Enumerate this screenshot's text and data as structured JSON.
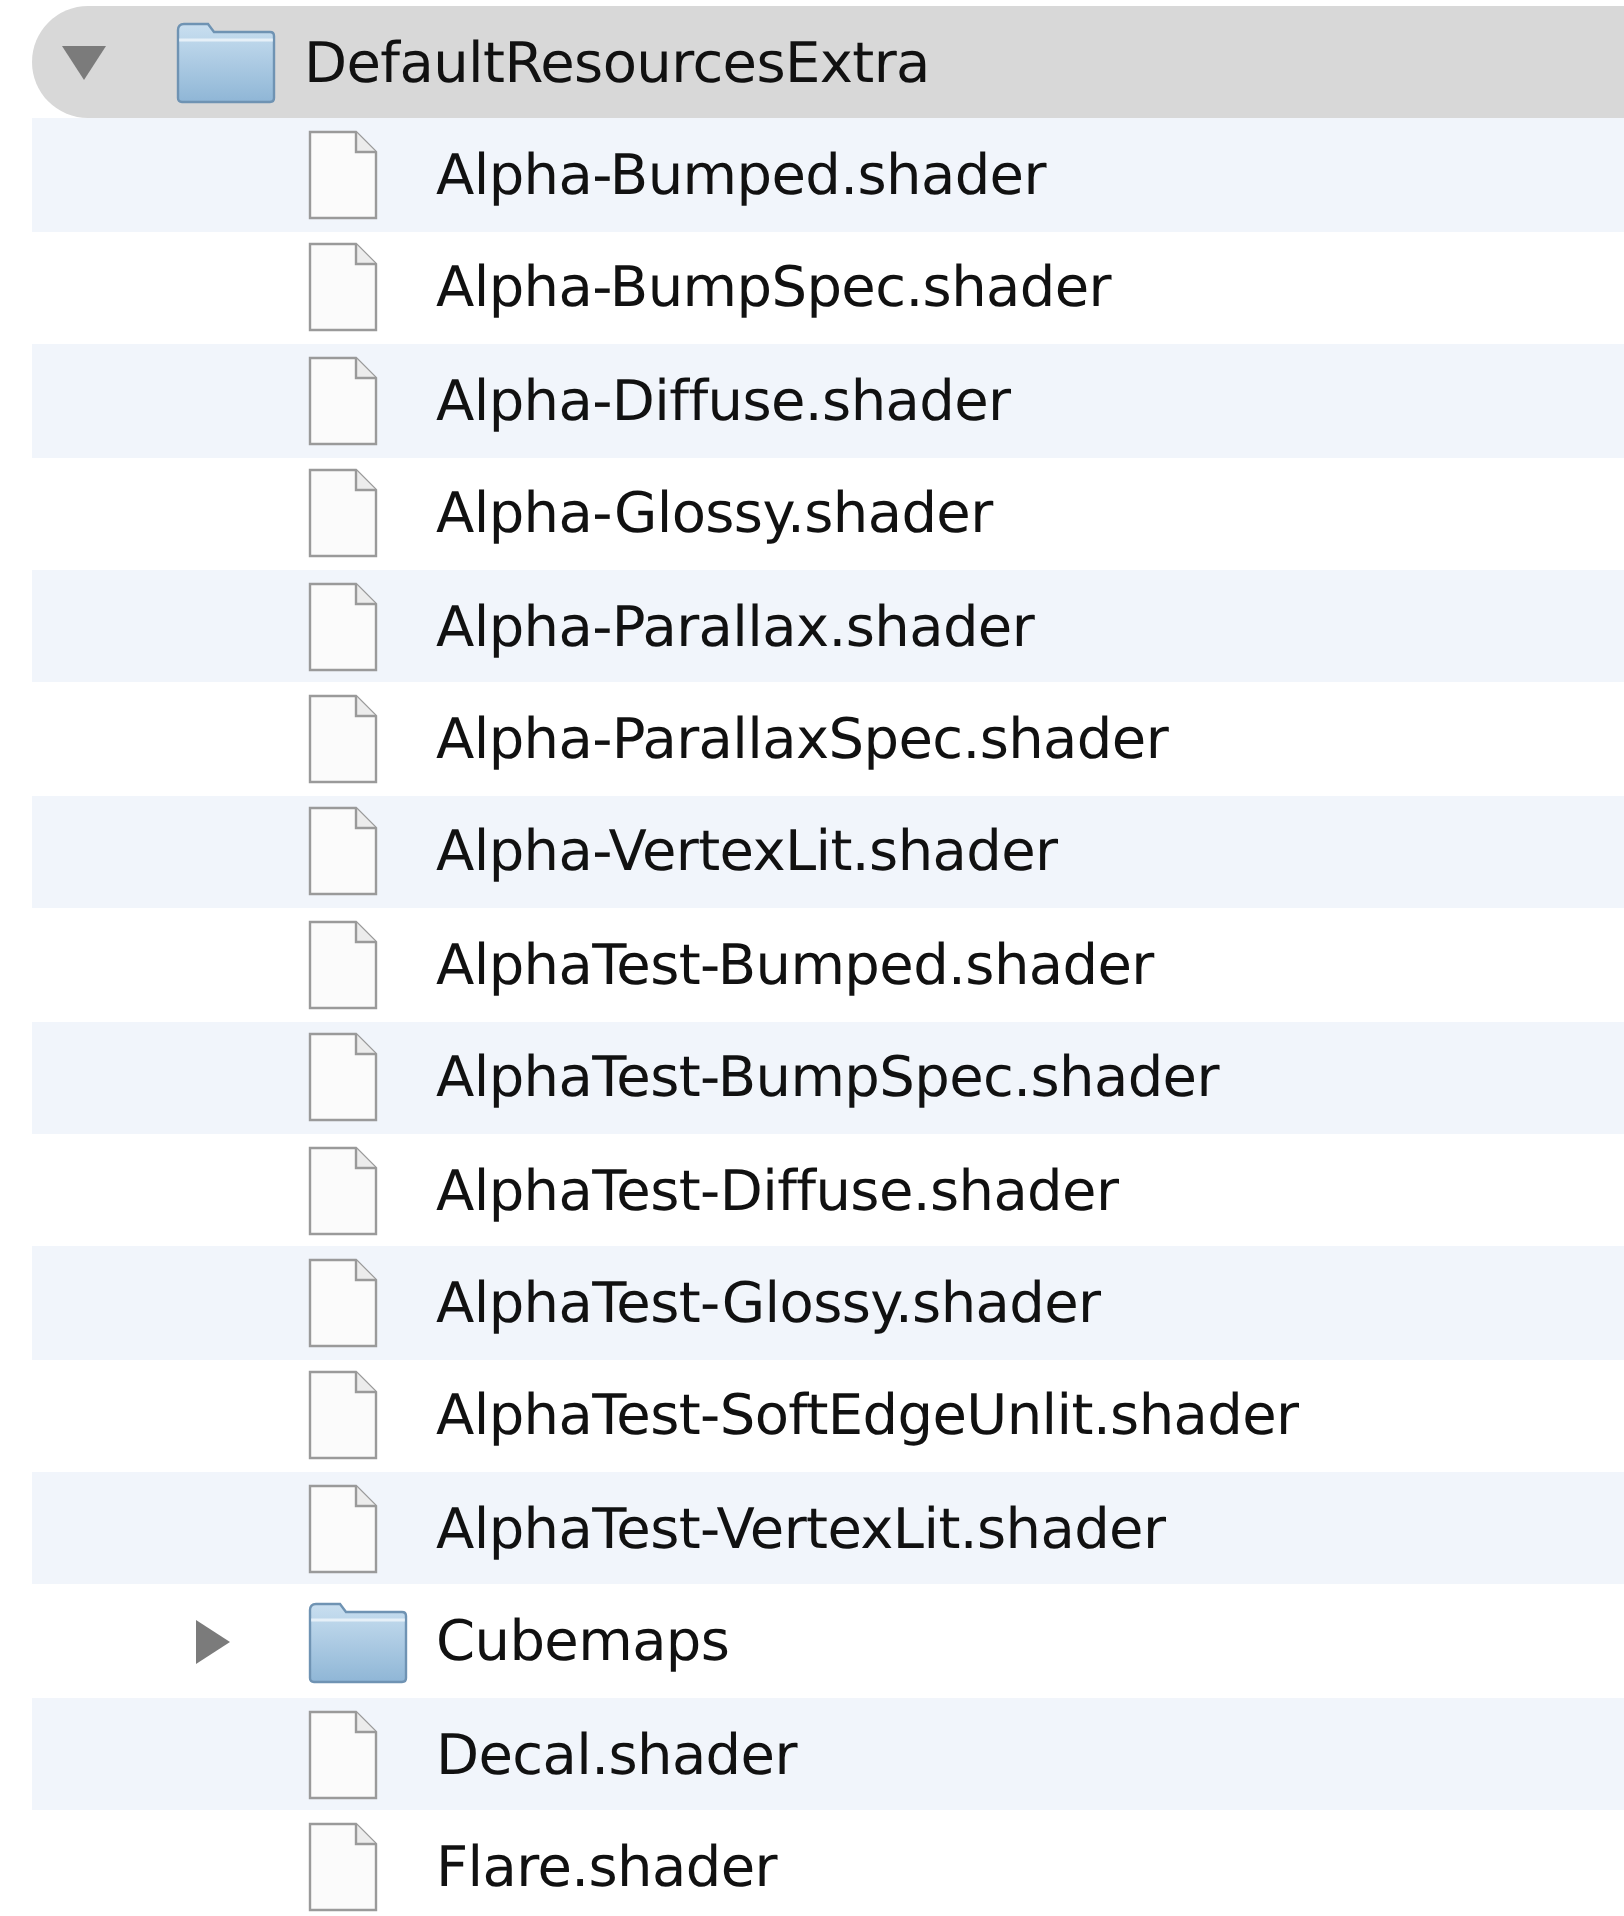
{
  "tree": [
    {
      "kind": "folder",
      "name": "DefaultResourcesExtra",
      "expanded": true,
      "selected": true,
      "children": [
        {
          "kind": "file",
          "name": "Alpha-Bumped.shader",
          "selected": false
        },
        {
          "kind": "file",
          "name": "Alpha-BumpSpec.shader",
          "selected": false
        },
        {
          "kind": "file",
          "name": "Alpha-Diffuse.shader",
          "selected": false
        },
        {
          "kind": "file",
          "name": "Alpha-Glossy.shader",
          "selected": false
        },
        {
          "kind": "file",
          "name": "Alpha-Parallax.shader",
          "selected": false
        },
        {
          "kind": "file",
          "name": "Alpha-ParallaxSpec.shader",
          "selected": false
        },
        {
          "kind": "file",
          "name": "Alpha-VertexLit.shader",
          "selected": false
        },
        {
          "kind": "file",
          "name": "AlphaTest-Bumped.shader",
          "selected": false
        },
        {
          "kind": "file",
          "name": "AlphaTest-BumpSpec.shader",
          "selected": false
        },
        {
          "kind": "file",
          "name": "AlphaTest-Diffuse.shader",
          "selected": false
        },
        {
          "kind": "file",
          "name": "AlphaTest-Glossy.shader",
          "selected": false
        },
        {
          "kind": "file",
          "name": "AlphaTest-SoftEdgeUnlit.shader",
          "selected": false
        },
        {
          "kind": "file",
          "name": "AlphaTest-VertexLit.shader",
          "selected": false
        },
        {
          "kind": "folder",
          "name": "Cubemaps",
          "expanded": false,
          "selected": false
        },
        {
          "kind": "file",
          "name": "Decal.shader",
          "selected": false
        },
        {
          "kind": "file",
          "name": "Flare.shader",
          "selected": false
        }
      ]
    }
  ]
}
